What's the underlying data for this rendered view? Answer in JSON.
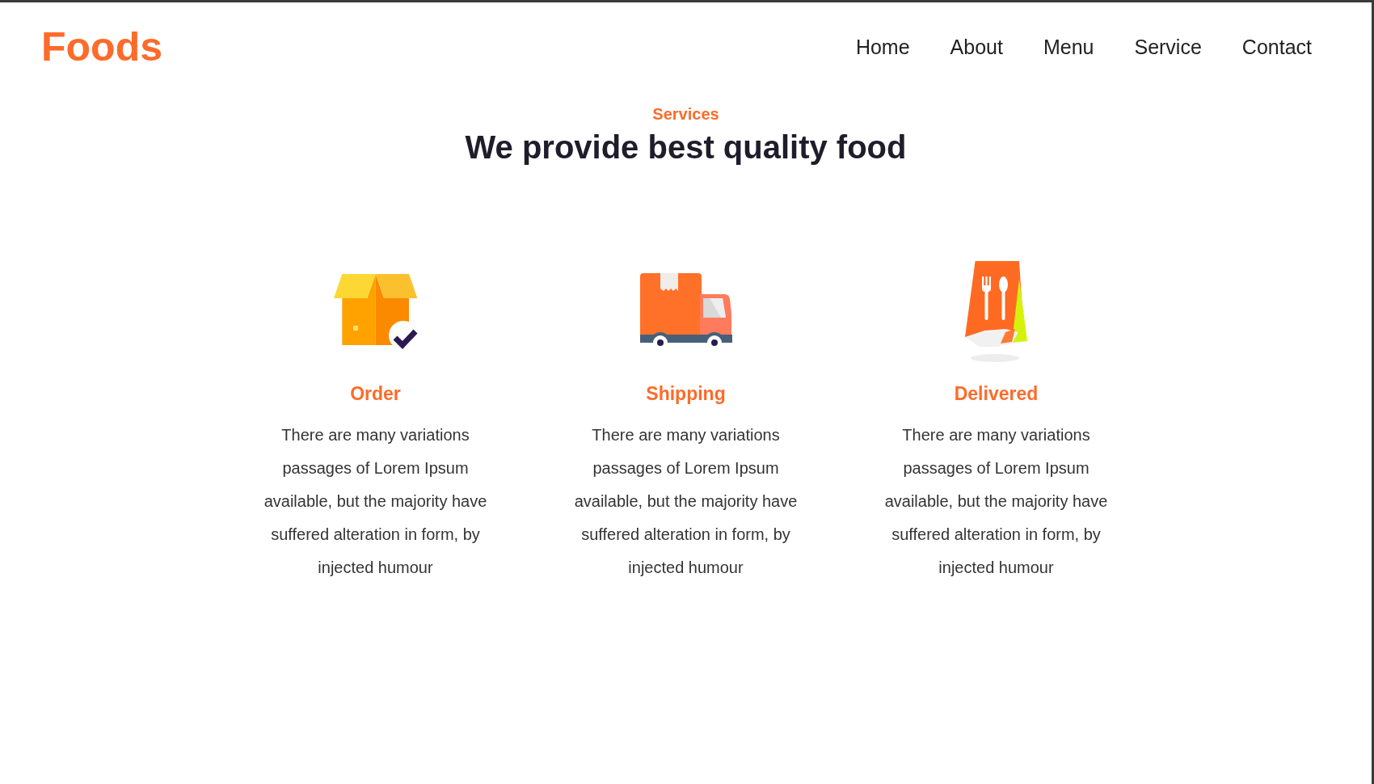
{
  "header": {
    "logo": "Foods",
    "nav": [
      "Home",
      "About",
      "Menu",
      "Service",
      "Contact"
    ]
  },
  "section": {
    "label": "Services",
    "title": "We provide best quality food"
  },
  "services": [
    {
      "kind": "box",
      "title": "Order",
      "text": "There are many variations passages of Lorem Ipsum available, but the majority have suffered alteration in form, by injected humour"
    },
    {
      "kind": "truck",
      "title": "Shipping",
      "text": "There are many variations passages of Lorem Ipsum available, but the majority have suffered alteration in form, by injected humour"
    },
    {
      "kind": "bag",
      "title": "Delivered",
      "text": "There are many variations passages of Lorem Ipsum available, but the majority have suffered alteration in form, by injected humour"
    }
  ]
}
